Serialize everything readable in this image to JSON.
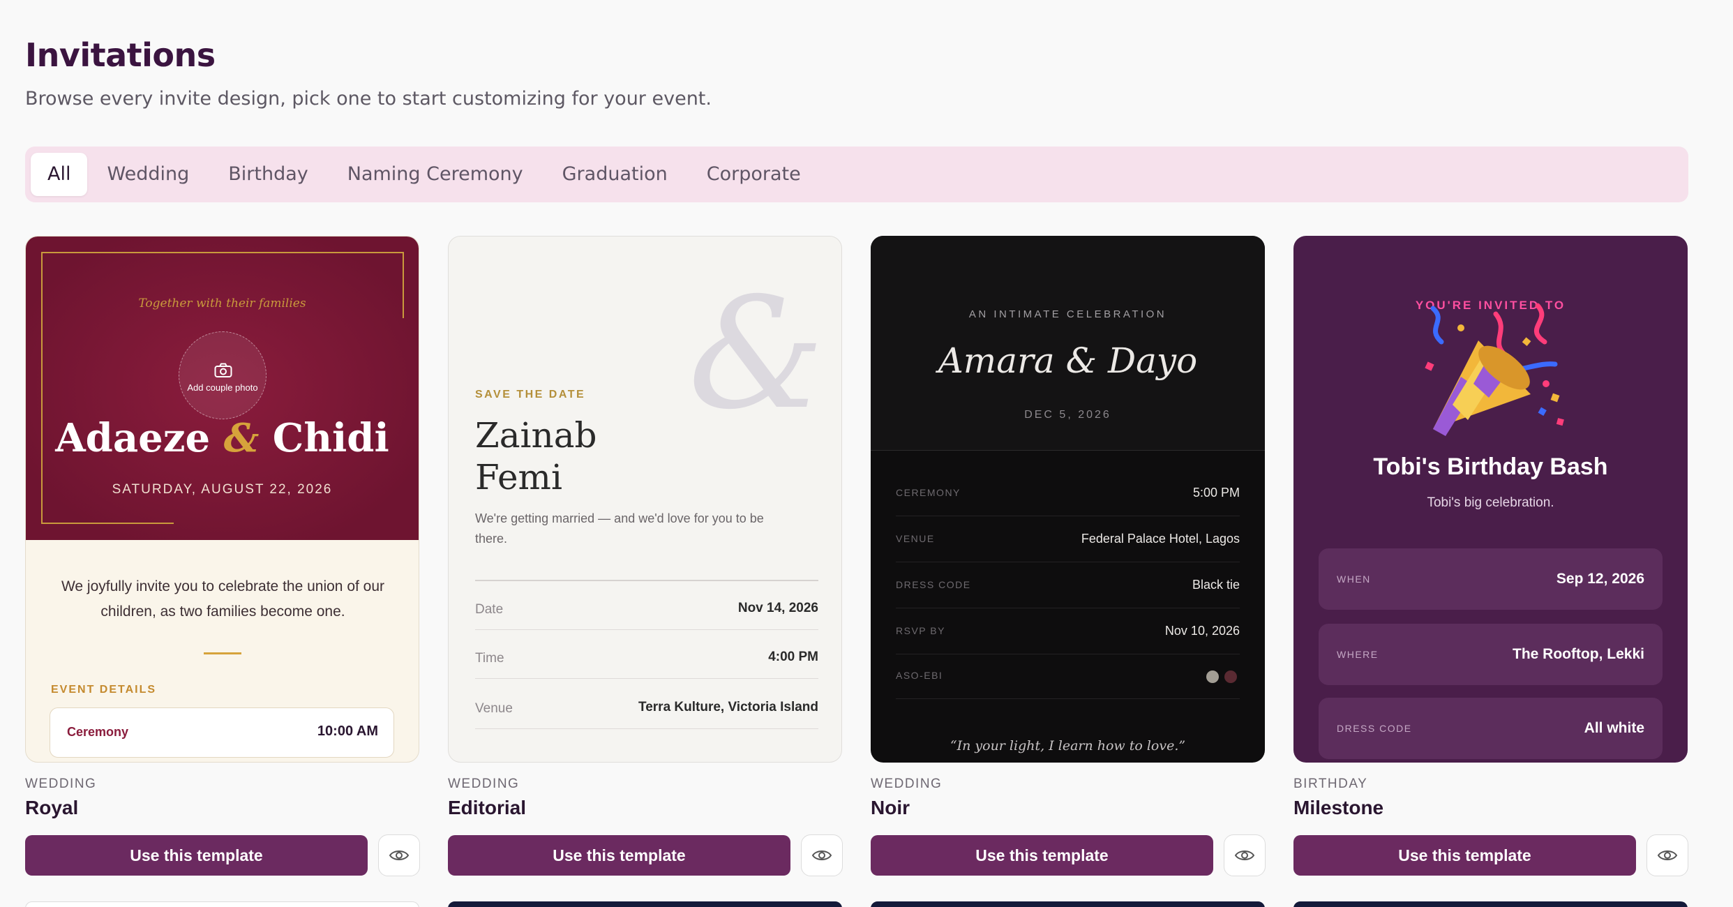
{
  "header": {
    "title": "Invitations",
    "subtitle": "Browse every invite design, pick one to start customizing for your event."
  },
  "tabs": [
    {
      "label": "All",
      "active": true
    },
    {
      "label": "Wedding",
      "active": false
    },
    {
      "label": "Birthday",
      "active": false
    },
    {
      "label": "Naming Ceremony",
      "active": false
    },
    {
      "label": "Graduation",
      "active": false
    },
    {
      "label": "Corporate",
      "active": false
    }
  ],
  "button_label": "Use this template",
  "templates": [
    {
      "category": "WEDDING",
      "name": "Royal",
      "preview": {
        "together": "Together with their families",
        "photo_label": "Add couple photo",
        "name1": "Adaeze",
        "amp": "&",
        "name2": "Chidi",
        "date": "SATURDAY, AUGUST 22, 2026",
        "invite": "We joyfully invite you to celebrate the union of our children, as two families become one.",
        "event_details_label": "EVENT DETAILS",
        "event_name": "Ceremony",
        "event_time": "10:00 AM"
      }
    },
    {
      "category": "WEDDING",
      "name": "Editorial",
      "preview": {
        "amp": "&",
        "save_the_date": "SAVE THE DATE",
        "name1": "Zainab",
        "name2": "Femi",
        "message": "We're getting married — and we'd love for you to be there.",
        "rows": [
          {
            "label": "Date",
            "value": "Nov 14, 2026"
          },
          {
            "label": "Time",
            "value": "4:00 PM"
          },
          {
            "label": "Venue",
            "value": "Terra Kulture, Victoria Island"
          }
        ]
      }
    },
    {
      "category": "WEDDING",
      "name": "Noir",
      "preview": {
        "tagline": "AN INTIMATE CELEBRATION",
        "names": "Amara & Dayo",
        "date": "DEC 5, 2026",
        "rows": [
          {
            "label": "CEREMONY",
            "value": "5:00 PM"
          },
          {
            "label": "VENUE",
            "value": "Federal Palace Hotel, Lagos"
          },
          {
            "label": "DRESS CODE",
            "value": "Black tie"
          },
          {
            "label": "RSVP BY",
            "value": "Nov 10, 2026"
          },
          {
            "label": "ASO-EBI",
            "value": ""
          }
        ],
        "swatches": [
          "#a39e95",
          "#5a2a32"
        ],
        "quote": "“In your light, I learn how to love.”"
      }
    },
    {
      "category": "BIRTHDAY",
      "name": "Milestone",
      "preview": {
        "kicker": "YOU'RE INVITED TO",
        "title": "Tobi's Birthday Bash",
        "subtitle": "Tobi's big celebration.",
        "rows": [
          {
            "label": "WHEN",
            "value": "Sep 12, 2026"
          },
          {
            "label": "WHERE",
            "value": "The Rooftop, Lekki"
          },
          {
            "label": "DRESS CODE",
            "value": "All white"
          }
        ]
      }
    }
  ],
  "colors": {
    "accent": "#6b2a60",
    "tab_bar": "#f6e1ec",
    "royal_red": "#7a1634",
    "gold": "#c99a3c",
    "noir_bg": "#0e0d0e",
    "milestone_bg": "#4a1e4a"
  }
}
